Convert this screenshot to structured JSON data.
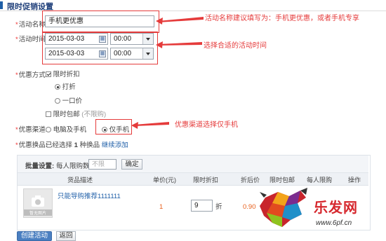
{
  "section": {
    "title": "限时促销设置"
  },
  "form": {
    "name": {
      "label": "活动名称:",
      "value": "手机更优惠"
    },
    "time": {
      "label": "活动时间:",
      "start_date": "2015-03-03",
      "start_time": "00:00",
      "end_date": "2015-03-03",
      "end_time": "00:00"
    },
    "discount": {
      "label": "优惠方式:",
      "limited_discount": "限时折扣",
      "opt_discount": "打折",
      "opt_fixed": "一口价",
      "free_shipping": "限时包邮",
      "free_shipping_note": "(不限购)"
    },
    "channel": {
      "label": "优惠渠道:",
      "opt_all": "电脑及手机",
      "opt_mobile": "仅手机"
    },
    "products": {
      "label": "优惠换品:",
      "text_pre": "已经选择",
      "count": "1",
      "text_post": "种换品",
      "add_link": "继续添加"
    }
  },
  "notes": {
    "name": "活动名称建议填写为：手机更优惠，或者手机专享",
    "time": "选择合适的活动时间",
    "channel": "优惠渠道选择仅手机"
  },
  "batch": {
    "label": "批量设置:",
    "per_person": "每人限购数",
    "placeholder": "不限",
    "confirm": "确定"
  },
  "table": {
    "headers": [
      "货品描述",
      "单价(元)",
      "限时折扣",
      "折后价",
      "限时包邮",
      "每人限购",
      "操作"
    ],
    "row": {
      "thumb_text": "暂无图片",
      "name": "只能导购推荐1111111",
      "price": "1",
      "discount_value": "9",
      "discount_unit": "折",
      "after_price": "0.90"
    }
  },
  "buttons": {
    "create": "创建活动",
    "back": "返回"
  },
  "watermark": {
    "brand": "乐发网",
    "url": "www.6pf.cn"
  },
  "colors": {
    "accent": "#1f5fa8",
    "highlight": "#e53b3b",
    "price": "#e8601c"
  }
}
